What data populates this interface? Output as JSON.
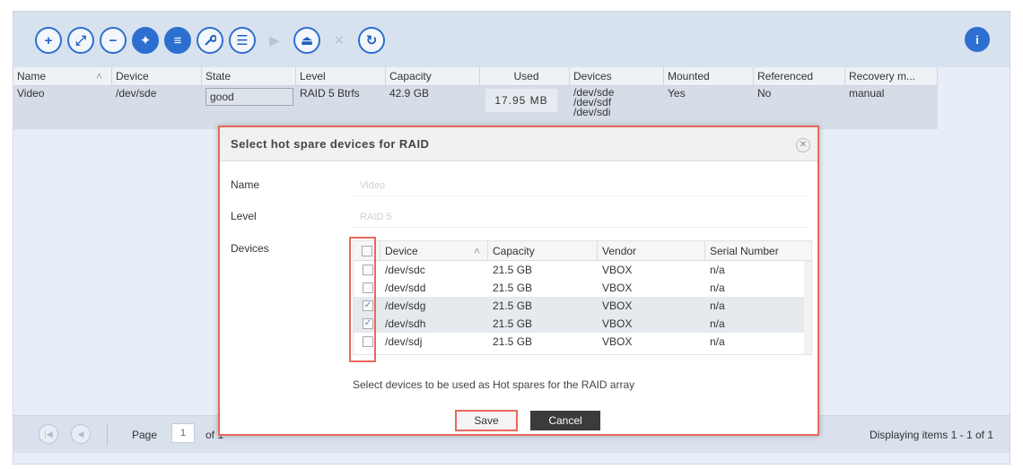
{
  "toolbar": {
    "buttons": [
      {
        "icon": "plus-icon",
        "glyph": "+"
      },
      {
        "icon": "expand-icon",
        "glyph": "⤢"
      },
      {
        "icon": "minus-icon",
        "glyph": "−"
      },
      {
        "icon": "puzzle-icon",
        "glyph": "✦"
      },
      {
        "icon": "database-icon",
        "glyph": "≡"
      },
      {
        "icon": "wrench-icon",
        "glyph": "🔧"
      },
      {
        "icon": "list-icon",
        "glyph": "☰"
      },
      {
        "icon": "play-icon",
        "glyph": "▶"
      },
      {
        "icon": "eject-icon",
        "glyph": "⏏"
      },
      {
        "icon": "close-icon",
        "glyph": "✕"
      },
      {
        "icon": "refresh-icon",
        "glyph": "↻"
      }
    ],
    "info_icon": "info-icon"
  },
  "grid": {
    "columns": [
      "Name",
      "Device",
      "State",
      "Level",
      "Capacity",
      "Used",
      "Devices",
      "Mounted",
      "Referenced",
      "Recovery m..."
    ],
    "sort_indicator": "˄",
    "row": {
      "name": "Video",
      "device": "/dev/sde",
      "state": "good",
      "level": "RAID 5 Btrfs",
      "capacity": "42.9 GB",
      "used": "17.95 MB",
      "devices": [
        "/dev/sde",
        "/dev/sdf",
        "/dev/sdi"
      ],
      "mounted": "Yes",
      "referenced": "No",
      "recovery": "manual"
    }
  },
  "pager": {
    "page_label": "Page",
    "page_value": "1",
    "of_label": "of 1",
    "display": "Displaying items 1 - 1 of 1"
  },
  "dialog": {
    "title": "Select hot spare devices for RAID",
    "name_label": "Name",
    "name_value": "Video",
    "level_label": "Level",
    "level_value": "RAID 5",
    "devices_label": "Devices",
    "table_columns": [
      "Device",
      "Capacity",
      "Vendor",
      "Serial Number"
    ],
    "rows": [
      {
        "device": "/dev/sdc",
        "capacity": "21.5 GB",
        "vendor": "VBOX",
        "serial": "n/a",
        "checked": false
      },
      {
        "device": "/dev/sdd",
        "capacity": "21.5 GB",
        "vendor": "VBOX",
        "serial": "n/a",
        "checked": false
      },
      {
        "device": "/dev/sdg",
        "capacity": "21.5 GB",
        "vendor": "VBOX",
        "serial": "n/a",
        "checked": true
      },
      {
        "device": "/dev/sdh",
        "capacity": "21.5 GB",
        "vendor": "VBOX",
        "serial": "n/a",
        "checked": true
      },
      {
        "device": "/dev/sdj",
        "capacity": "21.5 GB",
        "vendor": "VBOX",
        "serial": "n/a",
        "checked": false
      }
    ],
    "hint": "Select devices to be used as Hot spares for the RAID array",
    "save_label": "Save",
    "cancel_label": "Cancel",
    "checkmark": "✓",
    "close_glyph": "✕"
  },
  "colors": {
    "accent": "#2c6fd1",
    "highlight": "#e8695a",
    "toolbar_bg": "#d8e2ef"
  }
}
